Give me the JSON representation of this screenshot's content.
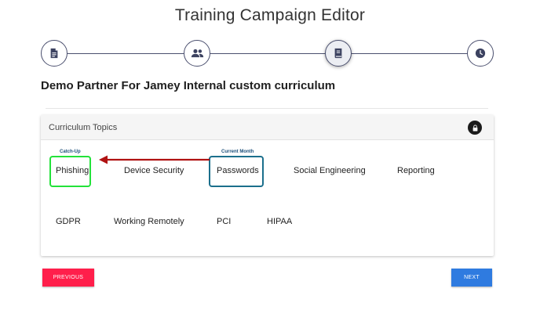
{
  "page": {
    "title": "Training Campaign Editor"
  },
  "stepper": {
    "steps": [
      {
        "icon": "document-icon"
      },
      {
        "icon": "users-icon"
      },
      {
        "icon": "book-icon",
        "active": true
      },
      {
        "icon": "clock-icon"
      }
    ]
  },
  "curriculum": {
    "title": "Demo Partner For Jamey Internal custom curriculum"
  },
  "topics_card": {
    "header": "Curriculum Topics",
    "lock_icon": "lock-icon",
    "tags": {
      "catch_up": "Catch-Up",
      "current_month": "Current Month"
    },
    "topics": [
      "Phishing",
      "Device Security",
      "Passwords",
      "Social Engineering",
      "Reporting",
      "GDPR",
      "Working Remotely",
      "PCI",
      "HIPAA"
    ],
    "annotation_colors": {
      "catch_up_border": "#23e23a",
      "current_border": "#1b6f8c",
      "arrow": "#b01212"
    }
  },
  "buttons": {
    "previous": "PREVIOUS",
    "next": "NEXT"
  },
  "colors": {
    "previous_bg": "#ff1f4b",
    "next_bg": "#2f7be0"
  }
}
